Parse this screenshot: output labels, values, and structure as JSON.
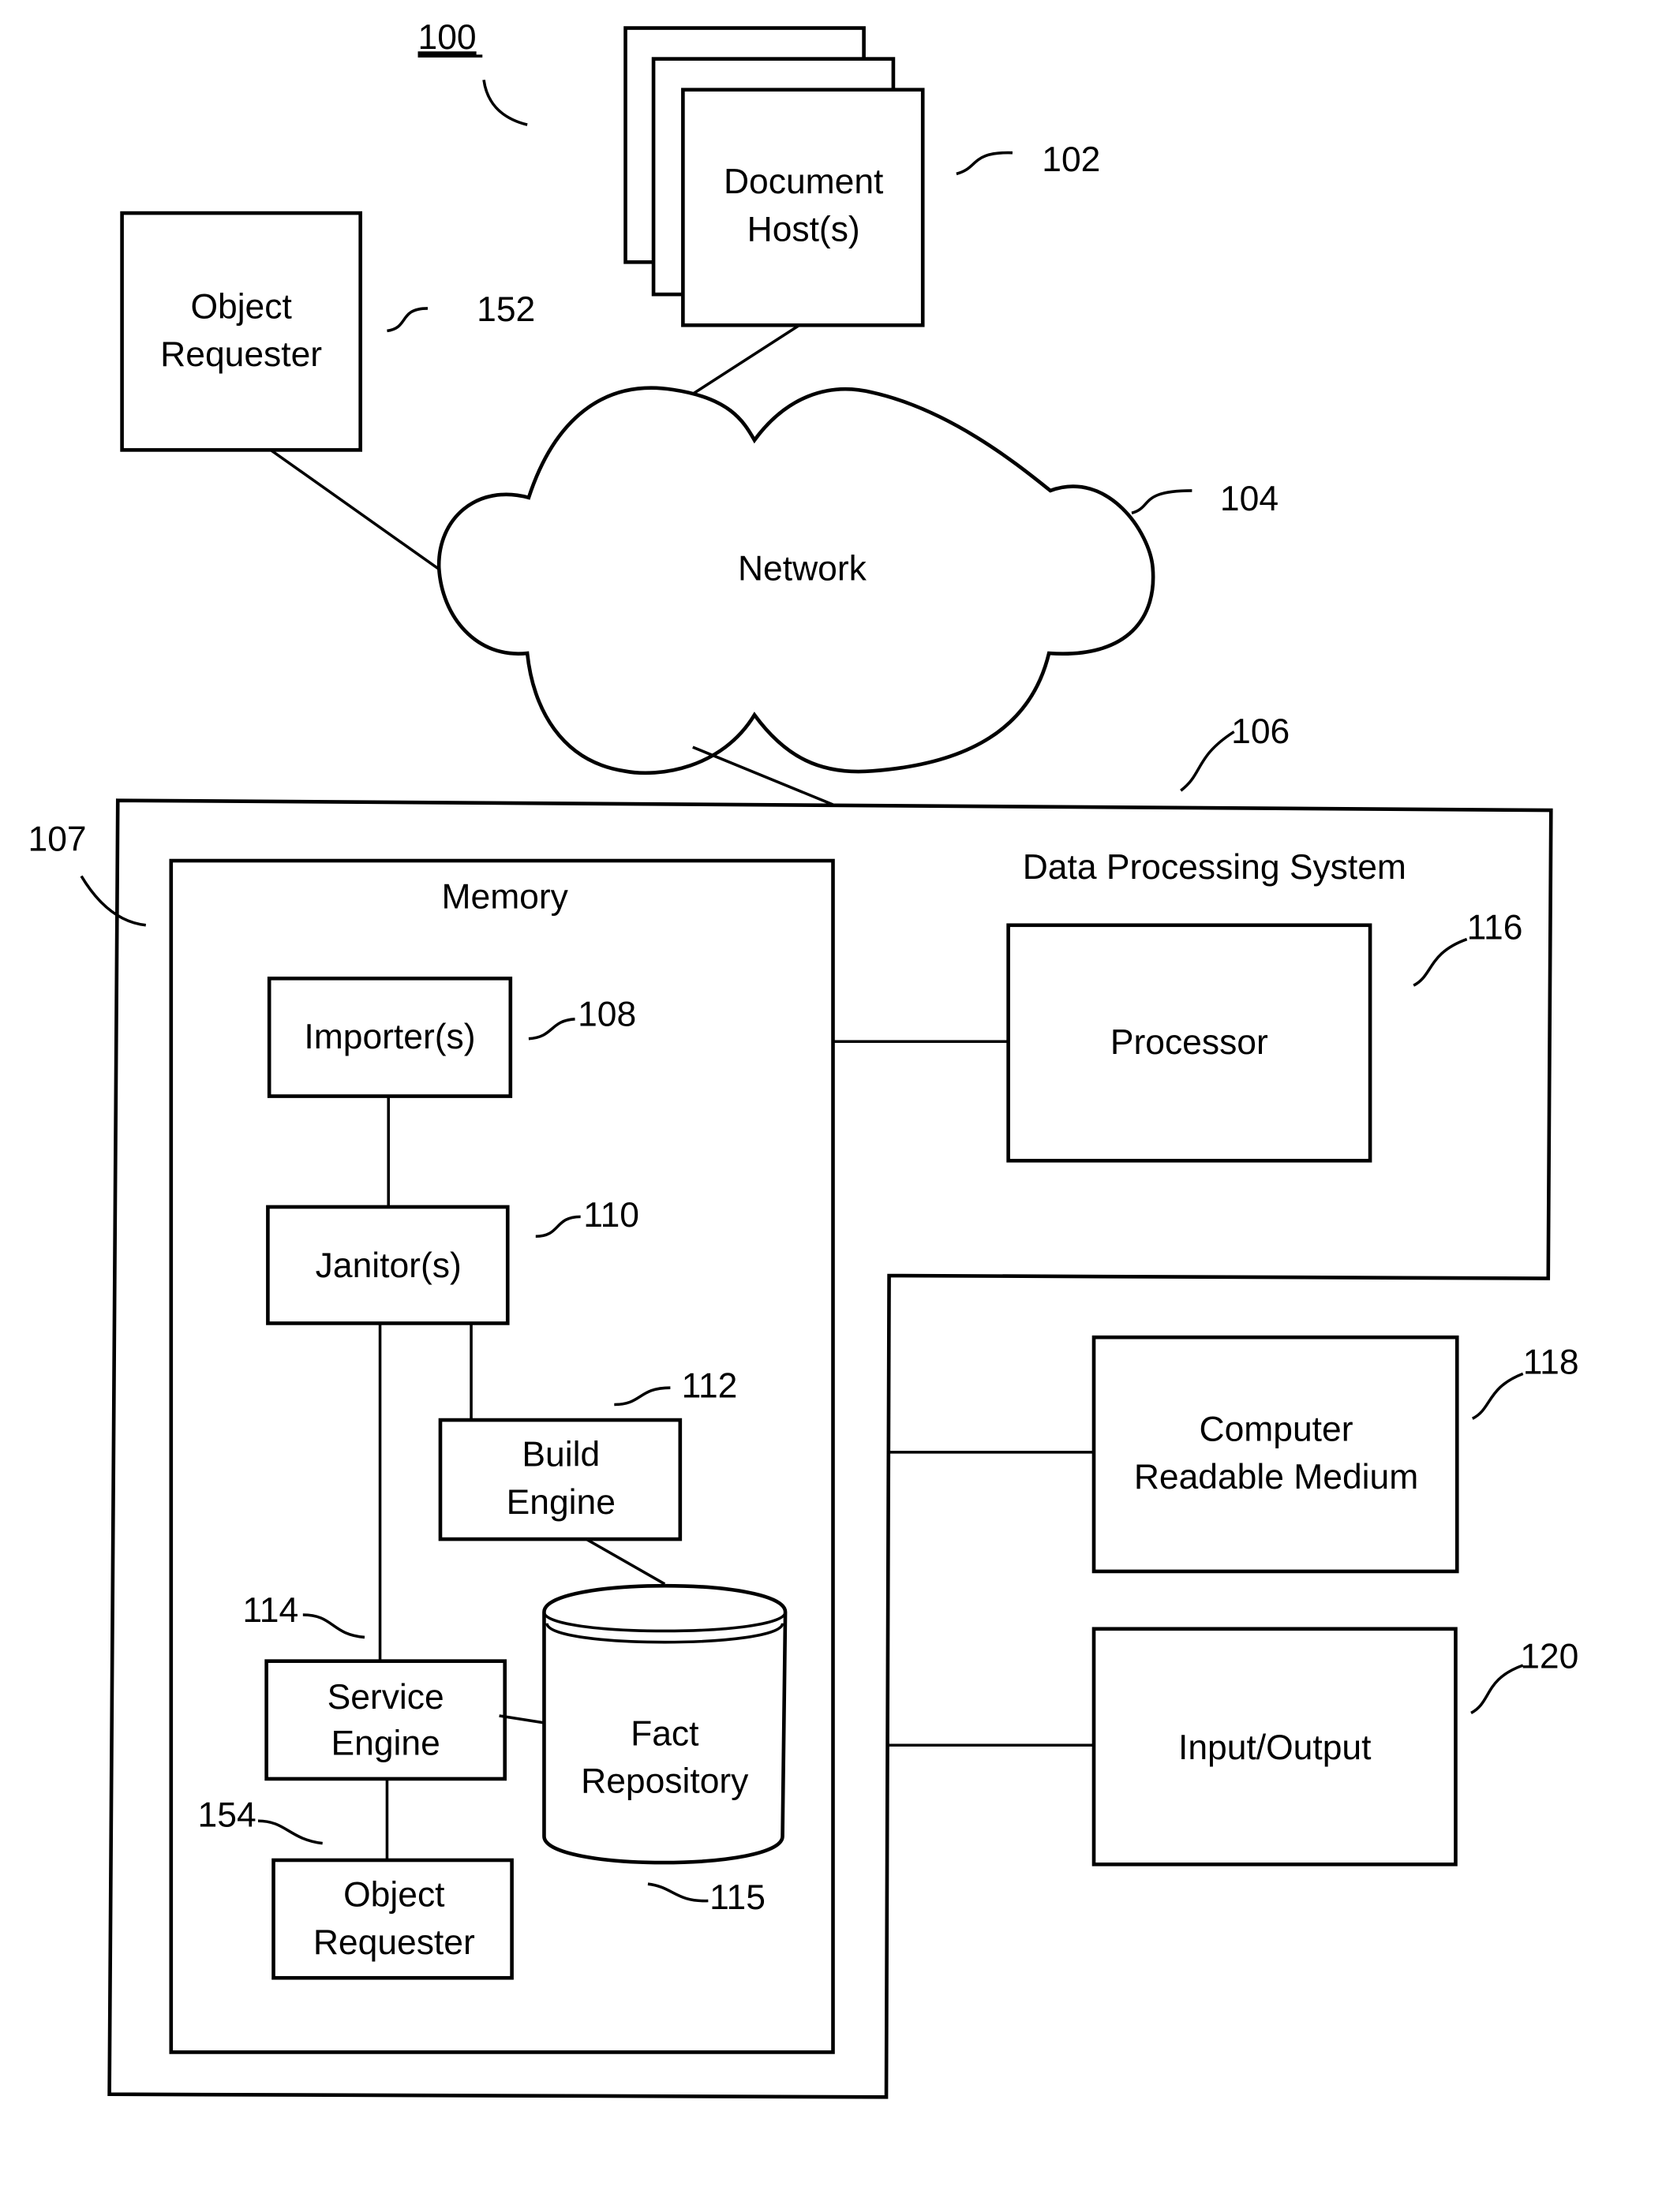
{
  "diagram": {
    "figure_ref": "100",
    "nodes": {
      "document_host": {
        "label_lines": [
          "Document",
          "Host(s)"
        ],
        "ref": "102"
      },
      "object_requester_ext": {
        "label_lines": [
          "Object",
          "Requester"
        ],
        "ref": "152"
      },
      "network": {
        "label": "Network",
        "ref": "104"
      },
      "data_processing_system": {
        "label": "Data Processing System",
        "ref": "106"
      },
      "system_ref_107": {
        "ref": "107"
      },
      "memory": {
        "label": "Memory"
      },
      "importer": {
        "label": "Importer(s)",
        "ref": "108"
      },
      "janitor": {
        "label": "Janitor(s)",
        "ref": "110"
      },
      "build_engine": {
        "label_lines": [
          "Build",
          "Engine"
        ],
        "ref": "112"
      },
      "service_engine": {
        "label_lines": [
          "Service",
          "Engine"
        ],
        "ref": "114"
      },
      "fact_repository": {
        "label_lines": [
          "Fact",
          "Repository"
        ],
        "ref": "115"
      },
      "object_requester_int": {
        "label_lines": [
          "Object",
          "Requester"
        ],
        "ref": "154"
      },
      "processor": {
        "label": "Processor",
        "ref": "116"
      },
      "crm": {
        "label_lines": [
          "Computer",
          "Readable Medium"
        ],
        "ref": "118"
      },
      "io": {
        "label": "Input/Output",
        "ref": "120"
      }
    },
    "edges": [
      [
        "document_host",
        "network"
      ],
      [
        "object_requester_ext",
        "network"
      ],
      [
        "network",
        "data_processing_system"
      ],
      [
        "importer",
        "janitor"
      ],
      [
        "janitor",
        "build_engine"
      ],
      [
        "janitor",
        "service_engine"
      ],
      [
        "build_engine",
        "fact_repository"
      ],
      [
        "service_engine",
        "fact_repository"
      ],
      [
        "service_engine",
        "object_requester_int"
      ],
      [
        "memory",
        "processor"
      ],
      [
        "memory",
        "crm"
      ],
      [
        "memory",
        "io"
      ]
    ]
  }
}
